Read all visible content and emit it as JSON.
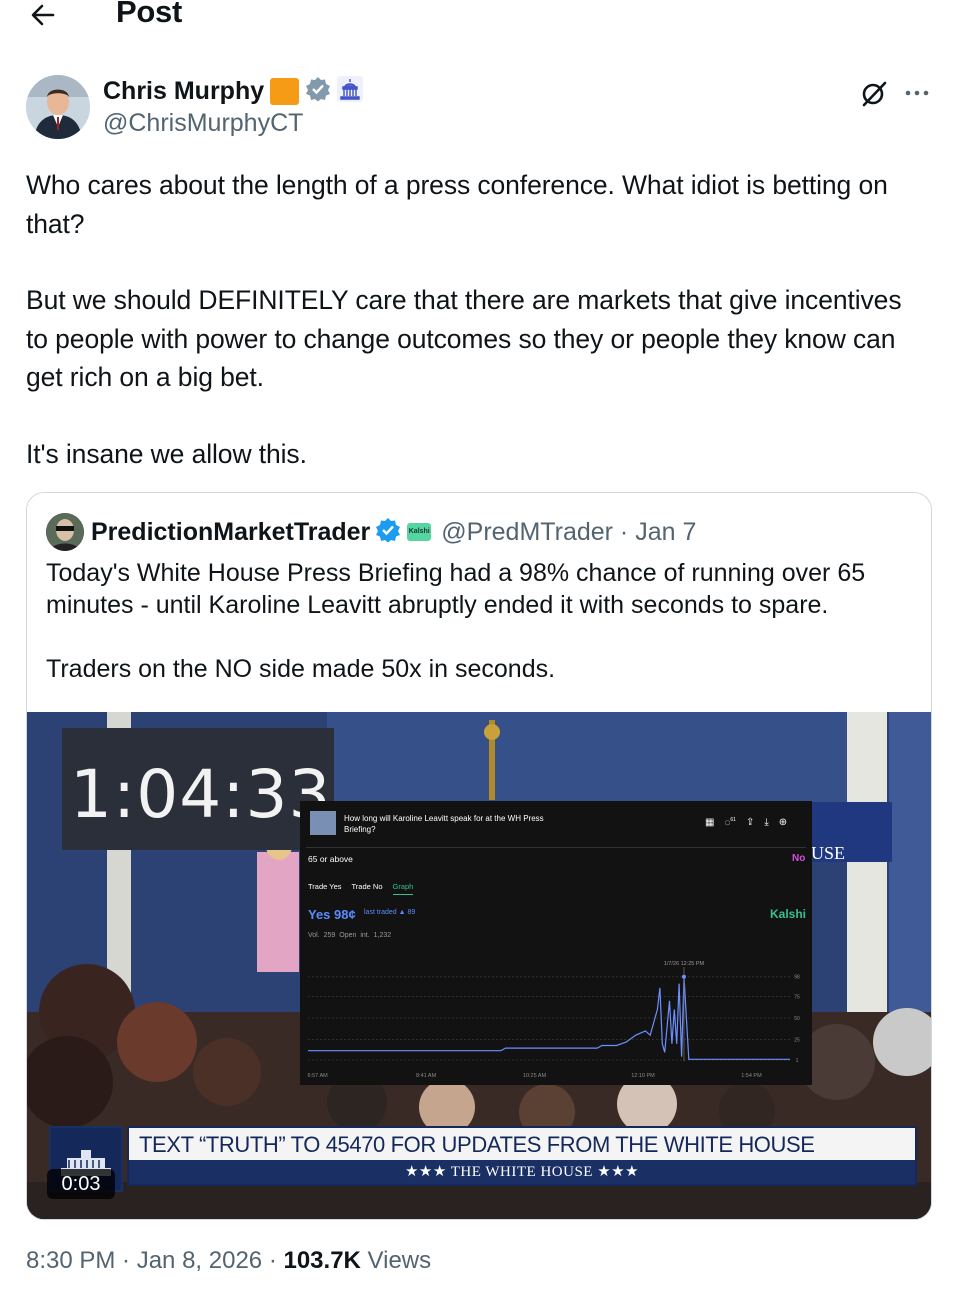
{
  "header": {
    "title": "Post"
  },
  "tweet": {
    "author": {
      "name": "Chris Murphy",
      "handle": "@ChrisMurphyCT"
    },
    "paragraphs": [
      "Who cares about the length of a press conference. What idiot is betting on that?",
      "But we should DEFINITELY care that there are markets that give incentives to people with power to change outcomes so they or people they know can get rich on a big bet.",
      "It's insane we allow this."
    ],
    "timestamp": "8:30 PM · Jan 8, 2026 · ",
    "views_count": "103.7K",
    "views_label": " Views"
  },
  "quote": {
    "name": "PredictionMarketTrader",
    "kalshi_badge": "Kalshi",
    "handle_date": "@PredMTrader · Jan 7",
    "paragraphs": [
      "Today's White House Press Briefing had a 98% chance of running over 65 minutes - until Karoline Leavitt abruptly ended it with seconds to spare.",
      "Traders on the NO side made 50x in seconds."
    ],
    "video": {
      "timer": "1:04:33",
      "duration": "0:03",
      "banner_text": "TEXT “TRUTH” TO 45470 FOR UPDATES FROM THE WHITE HOUSE",
      "banner_band": "★★★  THE WHITE HOUSE  ★★★",
      "side_text": "USE",
      "kalshi": {
        "question": "How long will Karoline Leavitt speak for at the WH Press Briefing?",
        "icon_count": "61",
        "outcome": "65 or above",
        "no_label": "No",
        "tabs": [
          "Trade Yes",
          "Trade No",
          "Graph"
        ],
        "yes_price": "Yes 98¢",
        "last_traded": "last traded ▲ 89",
        "brand": "Kalshi",
        "volume": "Vol. 259",
        "open_interest": "Open int. 1,232",
        "hover_label": "1/7/26 12:25 PM"
      }
    }
  },
  "chart_data": {
    "type": "line",
    "title": "",
    "x": [
      "6:57 AM",
      "8:41 AM",
      "10:25 AM",
      "12:10 PM",
      "1:54 PM"
    ],
    "y_ticks": [
      98,
      75,
      50,
      25,
      1
    ],
    "ylim": [
      0,
      100
    ],
    "series": [
      {
        "color": "#6d8fff",
        "points": [
          [
            0,
            12
          ],
          [
            0.4,
            12
          ],
          [
            0.41,
            15
          ],
          [
            0.6,
            15
          ],
          [
            0.61,
            18
          ],
          [
            0.64,
            18
          ],
          [
            0.66,
            22
          ],
          [
            0.68,
            30
          ],
          [
            0.7,
            35
          ],
          [
            0.71,
            30
          ],
          [
            0.72,
            50
          ],
          [
            0.725,
            60
          ],
          [
            0.73,
            85
          ],
          [
            0.735,
            20
          ],
          [
            0.74,
            10
          ],
          [
            0.75,
            70
          ],
          [
            0.755,
            20
          ],
          [
            0.76,
            60
          ],
          [
            0.765,
            20
          ],
          [
            0.77,
            90
          ],
          [
            0.775,
            5
          ],
          [
            0.78,
            98
          ],
          [
            0.79,
            2
          ],
          [
            1.0,
            2
          ]
        ]
      }
    ]
  }
}
